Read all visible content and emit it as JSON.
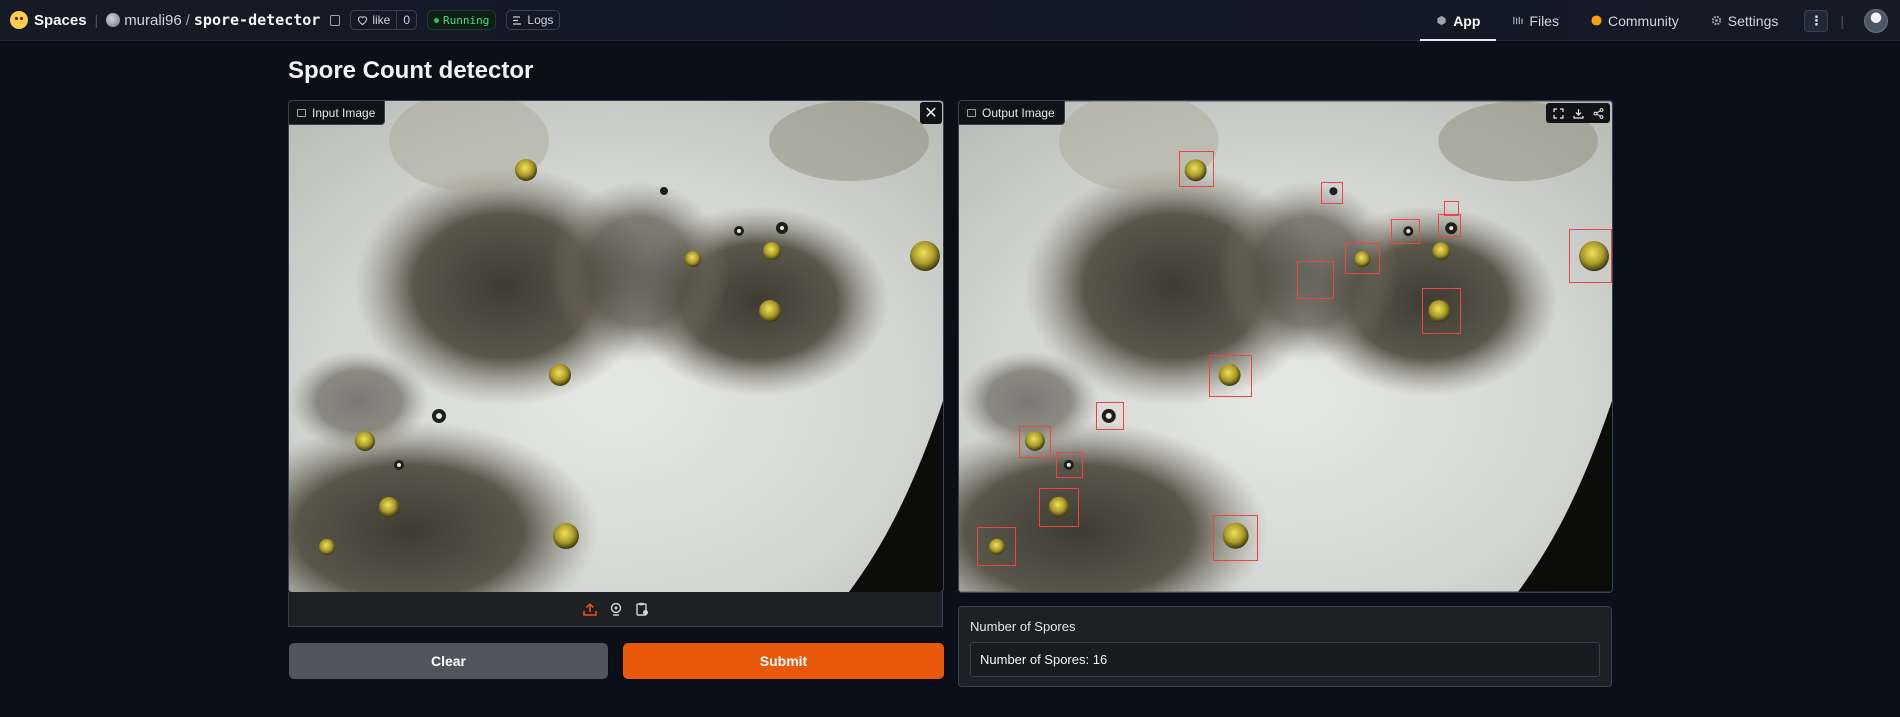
{
  "topbar": {
    "brand": "Spaces",
    "owner": "murali96",
    "slash": "/",
    "repo": "spore-detector",
    "like_label": "like",
    "like_count": "0",
    "status": "Running",
    "logs_label": "Logs",
    "nav": {
      "app": "App",
      "files": "Files",
      "community": "Community",
      "settings": "Settings"
    },
    "menu_glyph": "⋮"
  },
  "page": {
    "title": "Spore Count detector"
  },
  "input_panel": {
    "label": "Input Image",
    "close_glyph": "✕"
  },
  "output_panel": {
    "label": "Output Image"
  },
  "buttons": {
    "clear": "Clear",
    "submit": "Submit"
  },
  "result": {
    "label": "Number of Spores",
    "value": "Number of Spores: 16"
  },
  "colors": {
    "accent": "#ea580c",
    "running": "#4ade80",
    "detection_box": "#ef4444"
  }
}
